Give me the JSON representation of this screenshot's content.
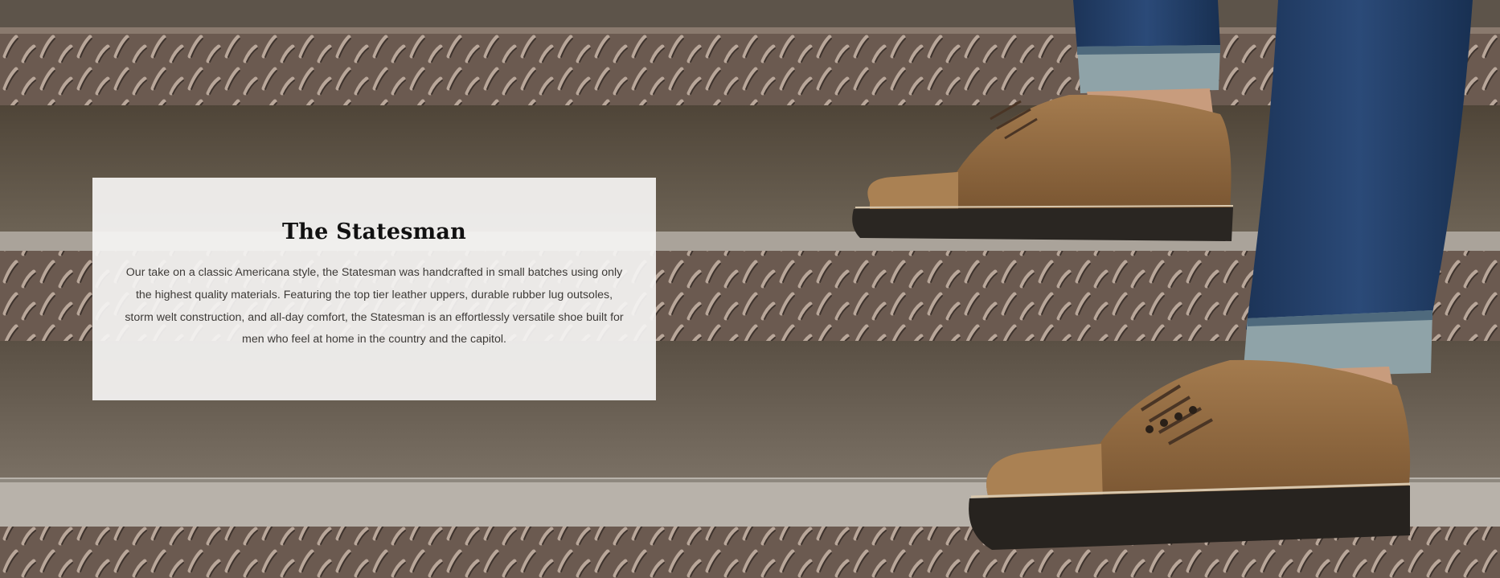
{
  "hero": {
    "title": "The Statesman",
    "description": "Our take on a classic Americana style, the Statesman was handcrafted in small batches using only the highest quality materials. Featuring the top tier leather uppers, durable rubber lug outsoles, storm welt construction, and all-day comfort, the Statesman is an effortlessly versatile shoe built for men who feel at home in the country and the capitol."
  },
  "colors": {
    "card_background": "#f5f4f3",
    "title": "#111111",
    "body_text": "#3d3a37",
    "leather": "#9a7247",
    "denim": "#223e66"
  },
  "image": {
    "subject": "brown cap-toe leather shoes with dark jeans walking up diamond-plate metal stairs"
  }
}
